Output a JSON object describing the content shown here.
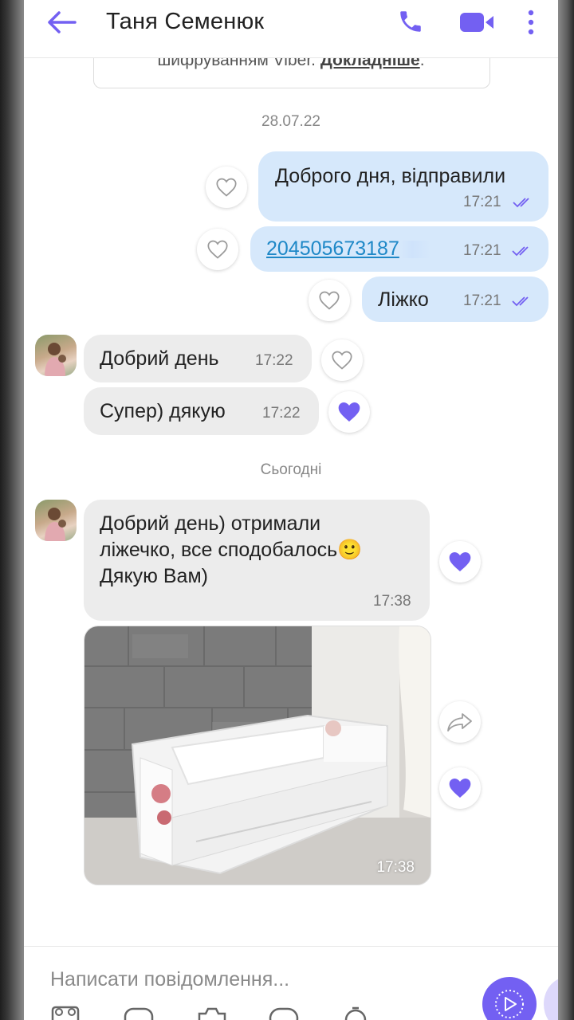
{
  "header": {
    "contact_name": "Таня Семенюк"
  },
  "encryption_note": {
    "text": "шифруванням Viber. ",
    "link": "Докладніше",
    "suffix": "."
  },
  "dates": {
    "first": "28.07.22",
    "today": "Сьогодні"
  },
  "messages": [
    {
      "direction": "outgoing",
      "text": "Доброго дня, відправили",
      "time": "17:21",
      "status": "read",
      "reaction": "none"
    },
    {
      "direction": "outgoing",
      "text": "204505673187",
      "time": "17:21",
      "status": "read",
      "reaction": "none",
      "is_link": true
    },
    {
      "direction": "outgoing",
      "text": "Ліжко",
      "time": "17:21",
      "status": "read",
      "reaction": "none"
    },
    {
      "direction": "incoming",
      "text": "Добрий день",
      "time": "17:22",
      "reaction": "none"
    },
    {
      "direction": "incoming",
      "text": "Супер) дякую",
      "time": "17:22",
      "reaction": "heart"
    },
    {
      "direction": "incoming",
      "lines": [
        "Добрий день) отримали",
        "ліжечко, все сподобалось🙂",
        "Дякую Вам)"
      ],
      "time": "17:38",
      "reaction": "heart"
    },
    {
      "direction": "incoming",
      "type": "photo",
      "time": "17:38",
      "reaction": "heart"
    }
  ],
  "composer": {
    "placeholder": "Написати повідомлення..."
  },
  "colors": {
    "accent": "#7360f2",
    "outgoing_bubble": "#d6e8fb",
    "incoming_bubble": "#ececec",
    "link": "#1e88c7"
  }
}
